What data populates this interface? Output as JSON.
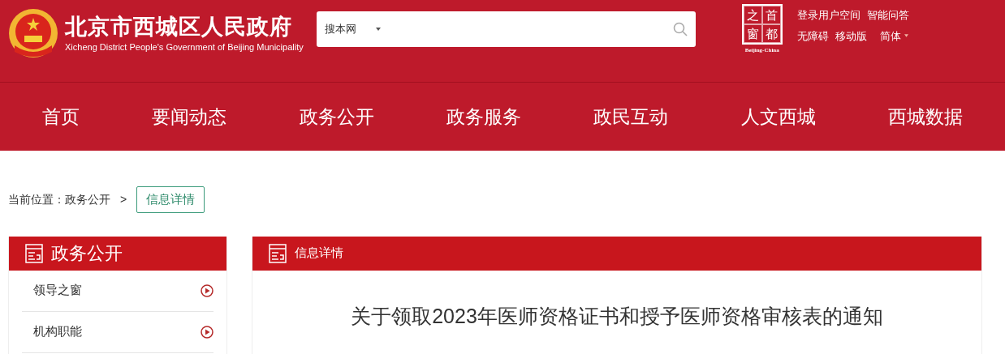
{
  "header": {
    "title": "北京市西城区人民政府",
    "subtitle": "Xicheng District People's Government of Beijing Municipality",
    "search": {
      "scope": "搜本网"
    },
    "logo": {
      "chars": [
        "之",
        "首",
        "窗",
        "都"
      ],
      "caption": "Beijing-China"
    },
    "links": [
      [
        "登录用户空间",
        "智能问答"
      ],
      [
        "无障碍",
        "移动版"
      ]
    ],
    "language": "简体"
  },
  "nav": [
    {
      "label": "首页",
      "selected": false
    },
    {
      "label": "要闻动态",
      "selected": false
    },
    {
      "label": "政务公开",
      "selected": false
    },
    {
      "label": "政务服务",
      "selected": false
    },
    {
      "label": "政民互动",
      "selected": false
    },
    {
      "label": "人文西城",
      "selected": false
    },
    {
      "label": "西城数据",
      "selected": false
    }
  ],
  "breadcrumb": {
    "prefix": "当前位置：",
    "items": [
      "政务公开"
    ],
    "separator": ">",
    "current": "信息详情"
  },
  "sidebar": {
    "title": "政务公开",
    "items": [
      "领导之窗",
      "机构职能"
    ]
  },
  "article": {
    "panel_title": "信息详情",
    "title": "关于领取2023年医师资格证书和授予医师资格审核表的通知"
  }
}
